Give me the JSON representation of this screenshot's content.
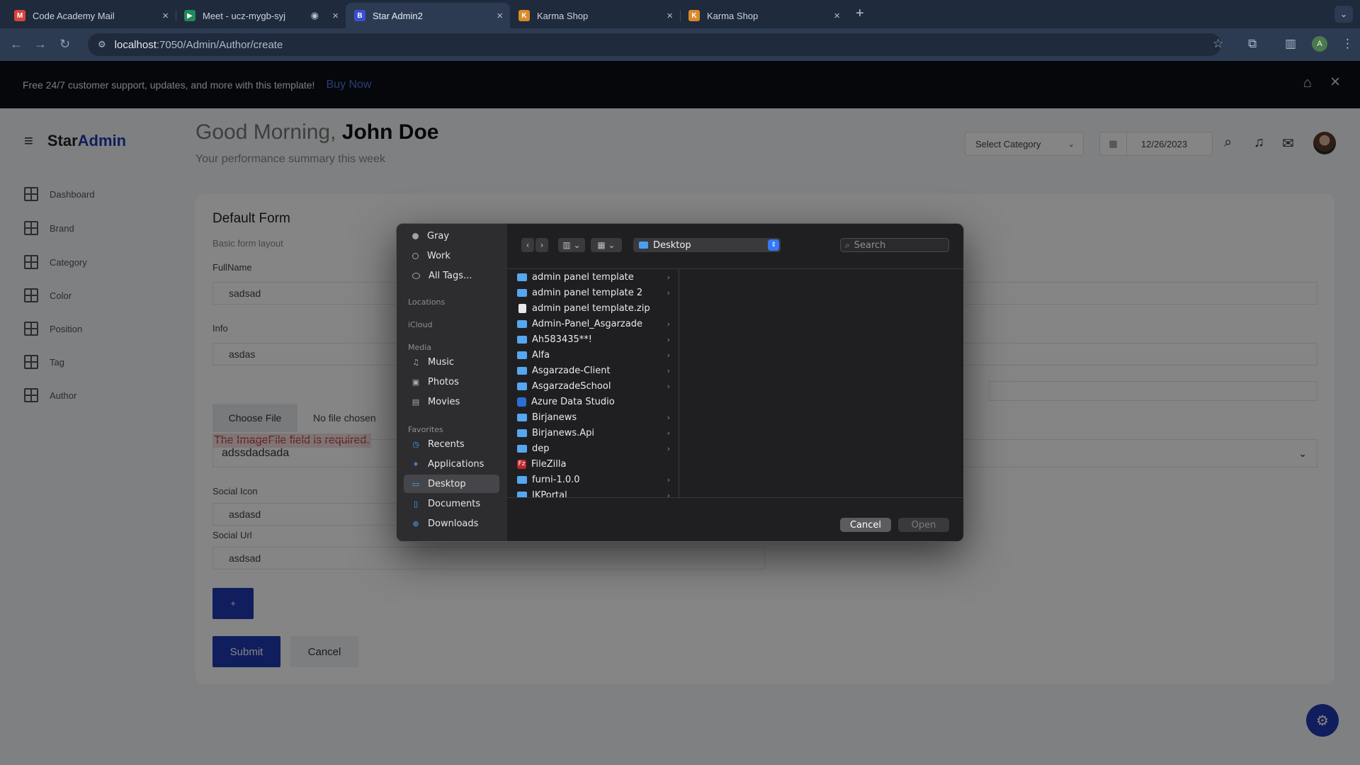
{
  "browser": {
    "tabs": [
      {
        "title": "Code Academy Mail",
        "favicon": "gmail-icon",
        "active": false
      },
      {
        "title": "Meet - ucz-mygb-syj",
        "favicon": "meet-icon",
        "active": false
      },
      {
        "title": "Star Admin2",
        "favicon": "bootstrap-icon",
        "active": true
      },
      {
        "title": "Karma Shop",
        "favicon": "karma-icon",
        "active": false
      },
      {
        "title": "Karma Shop",
        "favicon": "karma-icon",
        "active": false
      }
    ],
    "new_tab": "+",
    "tab_close": "×",
    "url_host": "localhost",
    "url_rest": ":7050/Admin/Author/create",
    "profile_initial": "A"
  },
  "promo": {
    "text": "Free 24/7 customer support, updates, and more with this template!",
    "link": "Buy Now"
  },
  "app": {
    "brand_prefix": "Star",
    "brand_suffix": "Admin",
    "greeting_prefix": "Good Morning, ",
    "user_name": "John Doe",
    "greeting_sub": "Your performance summary this week",
    "select_category": "Select Category",
    "date": "12/26/2023",
    "sidebar": [
      {
        "label": "Dashboard"
      },
      {
        "label": "Brand"
      },
      {
        "label": "Category"
      },
      {
        "label": "Color"
      },
      {
        "label": "Position"
      },
      {
        "label": "Tag"
      },
      {
        "label": "Author"
      }
    ]
  },
  "form": {
    "title": "Default Form",
    "subtitle": "Basic form layout",
    "fullname_label": "FullName",
    "fullname_value": "sadsad",
    "info_label": "Info",
    "info_value": "asdas",
    "choose_file": "Choose File",
    "no_file": "No file chosen",
    "image_error": "The ImageFile field is required.",
    "select_value": "adssdadsada",
    "social_icon_label": "Social Icon",
    "social_icon_value": "asdasd",
    "social_url_label": "Social Url",
    "social_url_value": "asdsad",
    "plus_label": "+",
    "submit_label": "Submit",
    "cancel_label": "Cancel"
  },
  "dialog": {
    "tags": [
      {
        "label": "Gray",
        "color": "#a0a0a5"
      },
      {
        "label": "Work",
        "color": "hollow"
      },
      {
        "label": "All Tags...",
        "color": "hollow"
      }
    ],
    "headings": {
      "locations": "Locations",
      "icloud": "iCloud",
      "media": "Media",
      "favorites": "Favorites"
    },
    "media": [
      {
        "label": "Music",
        "icon": "music-icon"
      },
      {
        "label": "Photos",
        "icon": "photos-icon"
      },
      {
        "label": "Movies",
        "icon": "movies-icon"
      }
    ],
    "favorites": [
      {
        "label": "Recents",
        "icon": "clock-icon"
      },
      {
        "label": "Applications",
        "icon": "applications-icon"
      },
      {
        "label": "Desktop",
        "icon": "desktop-icon",
        "selected": true
      },
      {
        "label": "Documents",
        "icon": "document-icon"
      },
      {
        "label": "Downloads",
        "icon": "download-icon"
      }
    ],
    "location": "Desktop",
    "search_placeholder": "Search",
    "files": [
      {
        "name": "admin panel template",
        "kind": "folder",
        "has_children": true
      },
      {
        "name": "admin panel template 2",
        "kind": "folder",
        "has_children": true
      },
      {
        "name": "admin panel template.zip",
        "kind": "file",
        "has_children": false
      },
      {
        "name": "Admin-Panel_Asgarzade",
        "kind": "folder",
        "has_children": true
      },
      {
        "name": "Ah583435**!",
        "kind": "folder",
        "has_children": true
      },
      {
        "name": "Alfa",
        "kind": "folder",
        "has_children": true
      },
      {
        "name": "Asgarzade-Client",
        "kind": "folder",
        "has_children": true
      },
      {
        "name": "AsgarzadeSchool",
        "kind": "folder",
        "has_children": true
      },
      {
        "name": "Azure Data Studio",
        "kind": "app",
        "has_children": false
      },
      {
        "name": "Birjanews",
        "kind": "folder",
        "has_children": true
      },
      {
        "name": "Birjanews.Api",
        "kind": "folder",
        "has_children": true
      },
      {
        "name": "dep",
        "kind": "folder",
        "has_children": true
      },
      {
        "name": "FileZilla",
        "kind": "filezilla",
        "has_children": false
      },
      {
        "name": "furni-1.0.0",
        "kind": "folder",
        "has_children": true
      },
      {
        "name": "IKPortal",
        "kind": "folder",
        "has_children": true
      }
    ],
    "cancel": "Cancel",
    "open": "Open"
  }
}
